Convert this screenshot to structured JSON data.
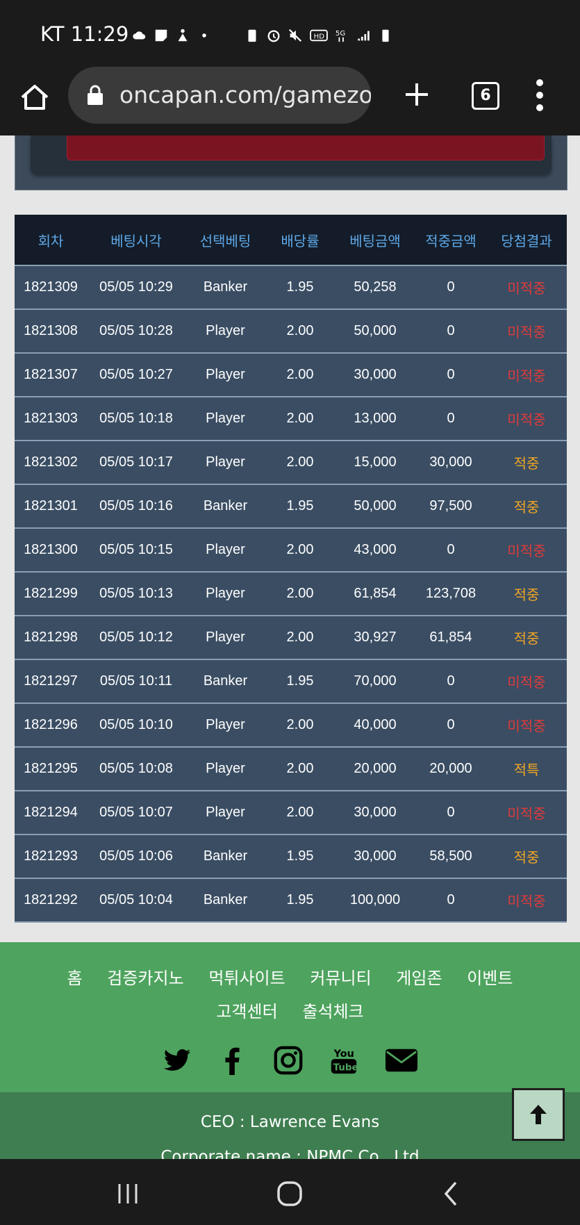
{
  "status": {
    "time": "KT 11:29"
  },
  "browser": {
    "url": "oncapan.com/gamezone",
    "tab_count": "6"
  },
  "table": {
    "headers": [
      "회차",
      "베팅시각",
      "선택베팅",
      "배당률",
      "베팅금액",
      "적중금액",
      "당첨결과"
    ],
    "rows": [
      [
        "1821309",
        "05/05 10:29",
        "Banker",
        "1.95",
        "50,258",
        "0",
        "미적중"
      ],
      [
        "1821308",
        "05/05 10:28",
        "Player",
        "2.00",
        "50,000",
        "0",
        "미적중"
      ],
      [
        "1821307",
        "05/05 10:27",
        "Player",
        "2.00",
        "30,000",
        "0",
        "미적중"
      ],
      [
        "1821303",
        "05/05 10:18",
        "Player",
        "2.00",
        "13,000",
        "0",
        "미적중"
      ],
      [
        "1821302",
        "05/05 10:17",
        "Player",
        "2.00",
        "15,000",
        "30,000",
        "적중"
      ],
      [
        "1821301",
        "05/05 10:16",
        "Banker",
        "1.95",
        "50,000",
        "97,500",
        "적중"
      ],
      [
        "1821300",
        "05/05 10:15",
        "Player",
        "2.00",
        "43,000",
        "0",
        "미적중"
      ],
      [
        "1821299",
        "05/05 10:13",
        "Player",
        "2.00",
        "61,854",
        "123,708",
        "적중"
      ],
      [
        "1821298",
        "05/05 10:12",
        "Player",
        "2.00",
        "30,927",
        "61,854",
        "적중"
      ],
      [
        "1821297",
        "05/05 10:11",
        "Banker",
        "1.95",
        "70,000",
        "0",
        "미적중"
      ],
      [
        "1821296",
        "05/05 10:10",
        "Player",
        "2.00",
        "40,000",
        "0",
        "미적중"
      ],
      [
        "1821295",
        "05/05 10:08",
        "Player",
        "2.00",
        "20,000",
        "20,000",
        "적특"
      ],
      [
        "1821294",
        "05/05 10:07",
        "Player",
        "2.00",
        "30,000",
        "0",
        "미적중"
      ],
      [
        "1821293",
        "05/05 10:06",
        "Banker",
        "1.95",
        "30,000",
        "58,500",
        "적중"
      ],
      [
        "1821292",
        "05/05 10:04",
        "Banker",
        "1.95",
        "100,000",
        "0",
        "미적중"
      ]
    ]
  },
  "footer": {
    "nav_links": [
      "홈",
      "검증카지노",
      "먹튀사이트",
      "커뮤니티",
      "게임존",
      "이벤트",
      "고객센터",
      "출석체크"
    ],
    "socials": [
      "twitter-icon",
      "facebook-icon",
      "instagram-icon",
      "youtube-icon",
      "mail-icon"
    ],
    "ceo": "CEO : Lawrence Evans",
    "corporate": "Corporate name : NPMC Co., Ltd"
  },
  "colors": {
    "lose": "#e23a3a",
    "win": "#f1a623",
    "header_text": "#5fa8e8",
    "footer_bg": "#4ea35e"
  }
}
